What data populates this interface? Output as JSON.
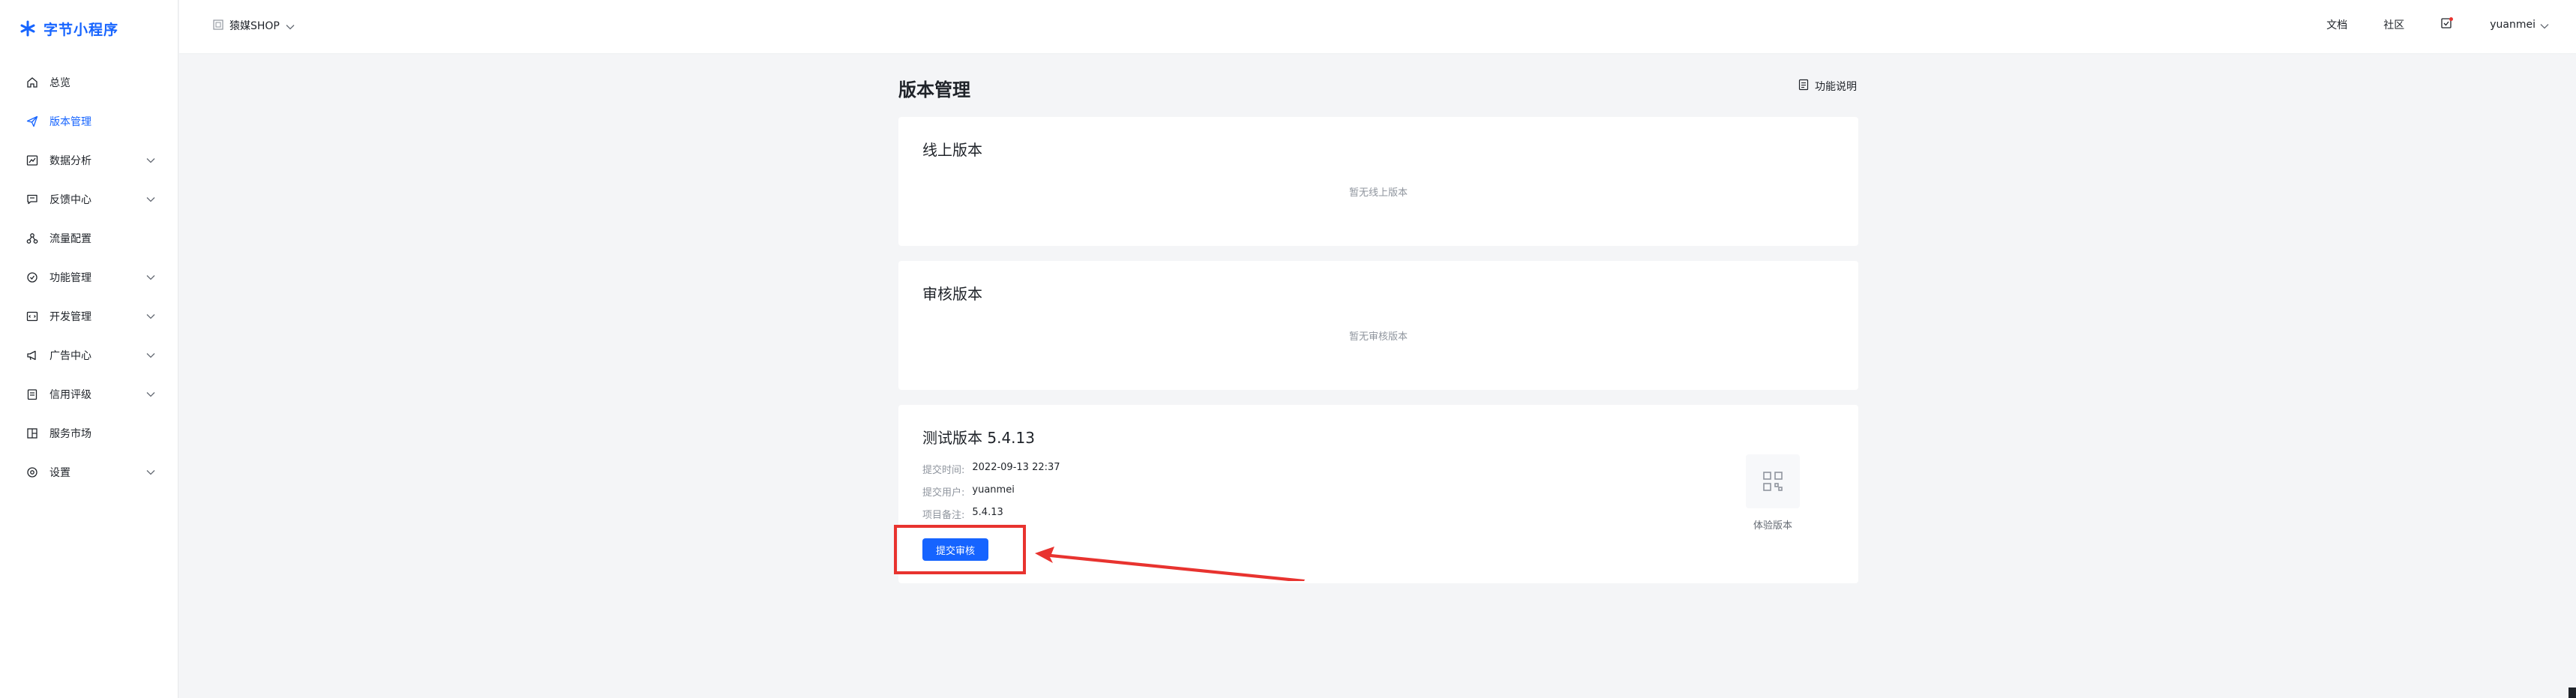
{
  "sidebar": {
    "logo": "字节小程序",
    "items": [
      {
        "label": "总览",
        "icon": "home-icon",
        "active": false,
        "expandable": false
      },
      {
        "label": "版本管理",
        "icon": "send-icon",
        "active": true,
        "expandable": false
      },
      {
        "label": "数据分析",
        "icon": "chart-icon",
        "active": false,
        "expandable": true
      },
      {
        "label": "反馈中心",
        "icon": "message-icon",
        "active": false,
        "expandable": true
      },
      {
        "label": "流量配置",
        "icon": "flow-icon",
        "active": false,
        "expandable": false
      },
      {
        "label": "功能管理",
        "icon": "function-icon",
        "active": false,
        "expandable": true
      },
      {
        "label": "开发管理",
        "icon": "code-icon",
        "active": false,
        "expandable": true
      },
      {
        "label": "广告中心",
        "icon": "megaphone-icon",
        "active": false,
        "expandable": true
      },
      {
        "label": "信用评级",
        "icon": "clipboard-icon",
        "active": false,
        "expandable": true
      },
      {
        "label": "服务市场",
        "icon": "grid-icon",
        "active": false,
        "expandable": false
      },
      {
        "label": "设置",
        "icon": "gear-icon",
        "active": false,
        "expandable": true
      }
    ]
  },
  "topbar": {
    "app_name": "猿媒SHOP",
    "docs": "文档",
    "community": "社区",
    "username": "yuanmei"
  },
  "main": {
    "title": "版本管理",
    "help_label": "功能说明",
    "online": {
      "title": "线上版本",
      "empty": "暂无线上版本"
    },
    "review": {
      "title": "审核版本",
      "empty": "暂无审核版本"
    },
    "test": {
      "title": "测试版本 5.4.13",
      "submit_time_label": "提交时间:",
      "submit_time": "2022-09-13 22:37",
      "submit_user_label": "提交用户:",
      "submit_user": "yuanmei",
      "remark_label": "项目备注:",
      "remark": "5.4.13",
      "submit_button": "提交审核",
      "qr_label": "体验版本"
    }
  },
  "colors": {
    "accent": "#1664ff",
    "annotation": "#e8332f"
  }
}
